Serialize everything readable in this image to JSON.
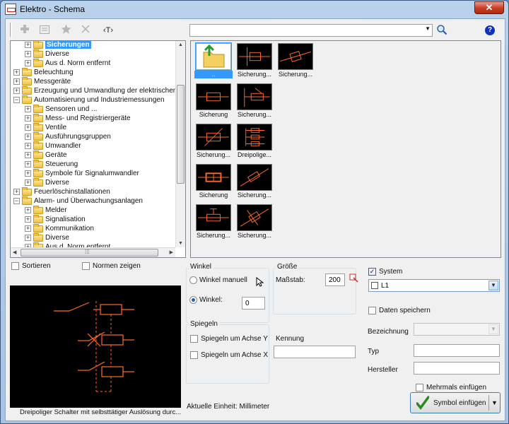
{
  "window": {
    "title": "Elektro - Schema",
    "close": "✕"
  },
  "toolbar": {
    "add_icon": "plus-icon",
    "props_icon": "properties-icon",
    "fav_icon": "star-icon",
    "delete_icon": "x-icon",
    "text_label": "‹T›",
    "search_value": "",
    "help": "?"
  },
  "tree": {
    "items": [
      {
        "label": "Sicherungen",
        "level": 2,
        "selected": true
      },
      {
        "label": "Diverse",
        "level": 2
      },
      {
        "label": "Aus d. Norm entfernt",
        "level": 2
      },
      {
        "label": "Beleuchtung",
        "level": 1
      },
      {
        "label": "Messgeräte",
        "level": 1
      },
      {
        "label": "Erzeugung und Umwandlung der elektrischen Energie",
        "level": 1
      },
      {
        "label": "Automatisierung und Industriemessungen",
        "level": 1,
        "expanded": true
      },
      {
        "label": "Sensoren und ...",
        "level": 2
      },
      {
        "label": "Mess- und Registriergeräte",
        "level": 2
      },
      {
        "label": "Ventile",
        "level": 2
      },
      {
        "label": "Ausführungsgruppen",
        "level": 2
      },
      {
        "label": "Umwandler",
        "level": 2
      },
      {
        "label": "Geräte",
        "level": 2
      },
      {
        "label": "Steuerung",
        "level": 2
      },
      {
        "label": "Symbole für Signalumwandler",
        "level": 2
      },
      {
        "label": "Diverse",
        "level": 2
      },
      {
        "label": "Feuerlöschinstallationen",
        "level": 1
      },
      {
        "label": "Alarm- und Überwachungsanlagen",
        "level": 1,
        "expanded": true
      },
      {
        "label": "Melder",
        "level": 2
      },
      {
        "label": "Signalisation",
        "level": 2
      },
      {
        "label": "Kommunikation",
        "level": 2
      },
      {
        "label": "Diverse",
        "level": 2
      },
      {
        "label": "Aus d. Norm entfernt",
        "level": 2
      }
    ],
    "scroll_grip": "⁞⁞⁞"
  },
  "symbols": [
    {
      "caption": "..",
      "kind": "folder-up",
      "selected": true
    },
    {
      "caption": "Sicherung...",
      "kind": "fuse-switch"
    },
    {
      "caption": "Sicherung...",
      "kind": "fuse-diag"
    },
    {
      "caption": "Sicherung",
      "kind": "fuse"
    },
    {
      "caption": "Sicherung...",
      "kind": "fuse-switch2"
    },
    {
      "caption": "Sicherung...",
      "kind": "fuse-slash"
    },
    {
      "caption": "Dreipolige...",
      "kind": "three-pole"
    },
    {
      "caption": "Sicherung",
      "kind": "fuse-bold"
    },
    {
      "caption": "Sicherung...",
      "kind": "fuse-diag2"
    },
    {
      "caption": "Sicherung...",
      "kind": "fuse-t"
    },
    {
      "caption": "Sicherung...",
      "kind": "fuse-diag3"
    }
  ],
  "options": {
    "sort_label": "Sortieren",
    "norms_label": "Normen zeigen"
  },
  "preview": {
    "caption": "Dreipoliger Schalter mit selbsttätiger Auslösung durc..."
  },
  "winkel": {
    "title": "Winkel",
    "manual_label": "Winkel manuell",
    "angle_label": "Winkel:",
    "angle_value": "0"
  },
  "groesse": {
    "title": "Größe",
    "scale_label": "Maßstab:",
    "scale_value": "200"
  },
  "spiegeln": {
    "title": "Spiegeln",
    "y_label": "Spiegeln um Achse Y",
    "x_label": "Spiegeln um Achse X"
  },
  "kennung": {
    "label": "Kennung",
    "value": ""
  },
  "unit_text": "Aktuelle Einheit: Millimeter",
  "system": {
    "label": "System",
    "layer_value": "L1"
  },
  "save_data_label": "Daten speichern",
  "fields": {
    "bezeichnung": "Bezeichnung",
    "typ": "Typ",
    "hersteller": "Hersteller"
  },
  "multi_insert_label": "Mehrmals einfügen",
  "insert_button": "Symbol einfügen",
  "colors": {
    "symbol_line": "#ff6a2a",
    "selection": "#3399ff",
    "title_bg": "#b9d1ea"
  }
}
